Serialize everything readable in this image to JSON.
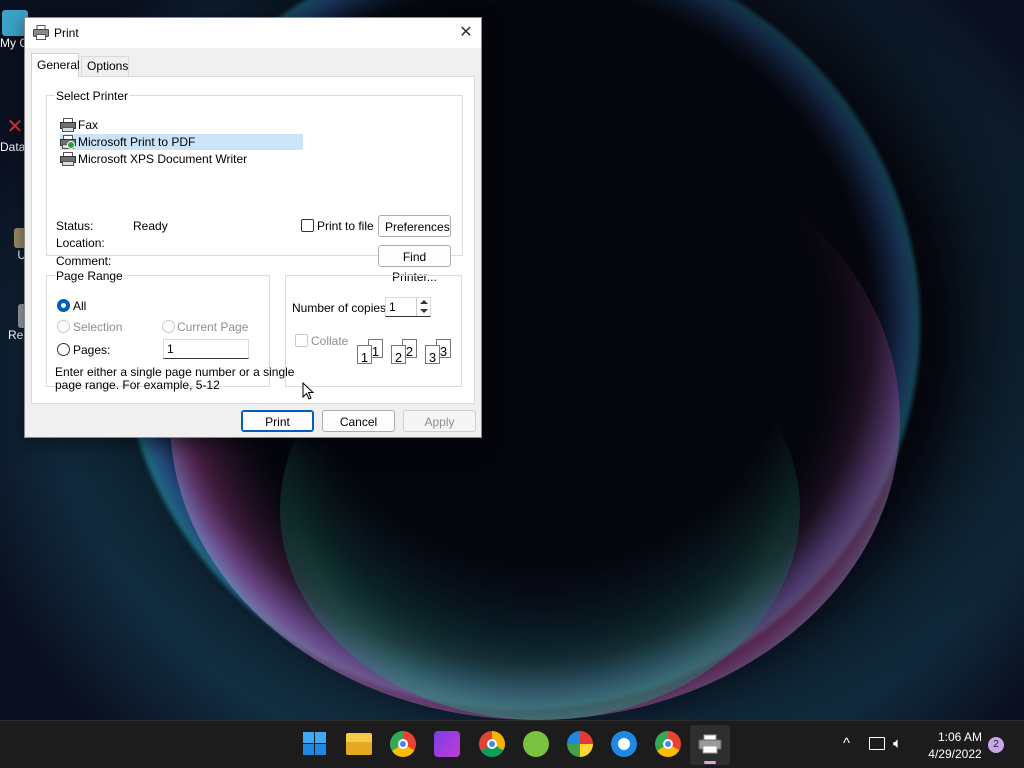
{
  "desktop": {
    "icons": [
      {
        "label": "My C"
      },
      {
        "label": "Data"
      },
      {
        "label": "U"
      },
      {
        "label": "Re"
      }
    ]
  },
  "dialog": {
    "title": "Print",
    "close_glyph": "✕",
    "tabs": [
      {
        "label": "General",
        "active": true
      },
      {
        "label": "Options",
        "active": false
      }
    ],
    "select_printer": {
      "group_label": "Select Printer",
      "printers": [
        {
          "name": "Fax",
          "selected": false
        },
        {
          "name": "Microsoft Print to PDF",
          "selected": true
        },
        {
          "name": "Microsoft XPS Document Writer",
          "selected": false
        }
      ],
      "status_label": "Status:",
      "status_value": "Ready",
      "location_label": "Location:",
      "comment_label": "Comment:",
      "print_to_file_label": "Print to file",
      "print_to_file_checked": false,
      "preferences_button": "Preferences",
      "find_printer_button": "Find Printer..."
    },
    "page_range": {
      "group_label": "Page Range",
      "all_label": "All",
      "selection_label": "Selection",
      "current_page_label": "Current Page",
      "pages_label": "Pages:",
      "pages_value": "1",
      "selected_option": "All",
      "help_text_line1": "Enter either a single page number or a single",
      "help_text_line2": "page range.  For example, 5-12"
    },
    "copies": {
      "number_label": "Number of copies:",
      "number_value": "1",
      "collate_label": "Collate",
      "collate_checked": false,
      "collate_pages": [
        "1",
        "1",
        "2",
        "2",
        "3",
        "3"
      ]
    },
    "buttons": {
      "print": "Print",
      "cancel": "Cancel",
      "apply": "Apply"
    }
  },
  "taskbar": {
    "apps": [
      "start-icon",
      "file-explorer-icon",
      "chrome-icon",
      "app-s-icon",
      "chrome-canary-icon",
      "app-green-icon",
      "chromium-icon",
      "edge-icon",
      "chrome-icon-2",
      "printer-app-icon"
    ],
    "tray": {
      "chevron": "^",
      "time": "1:06 AM",
      "date": "4/29/2022",
      "notification_count": "2"
    }
  },
  "colors": {
    "accent": "#005fb8",
    "selection": "#cce4f7",
    "taskbar": "#1c1c1c"
  }
}
